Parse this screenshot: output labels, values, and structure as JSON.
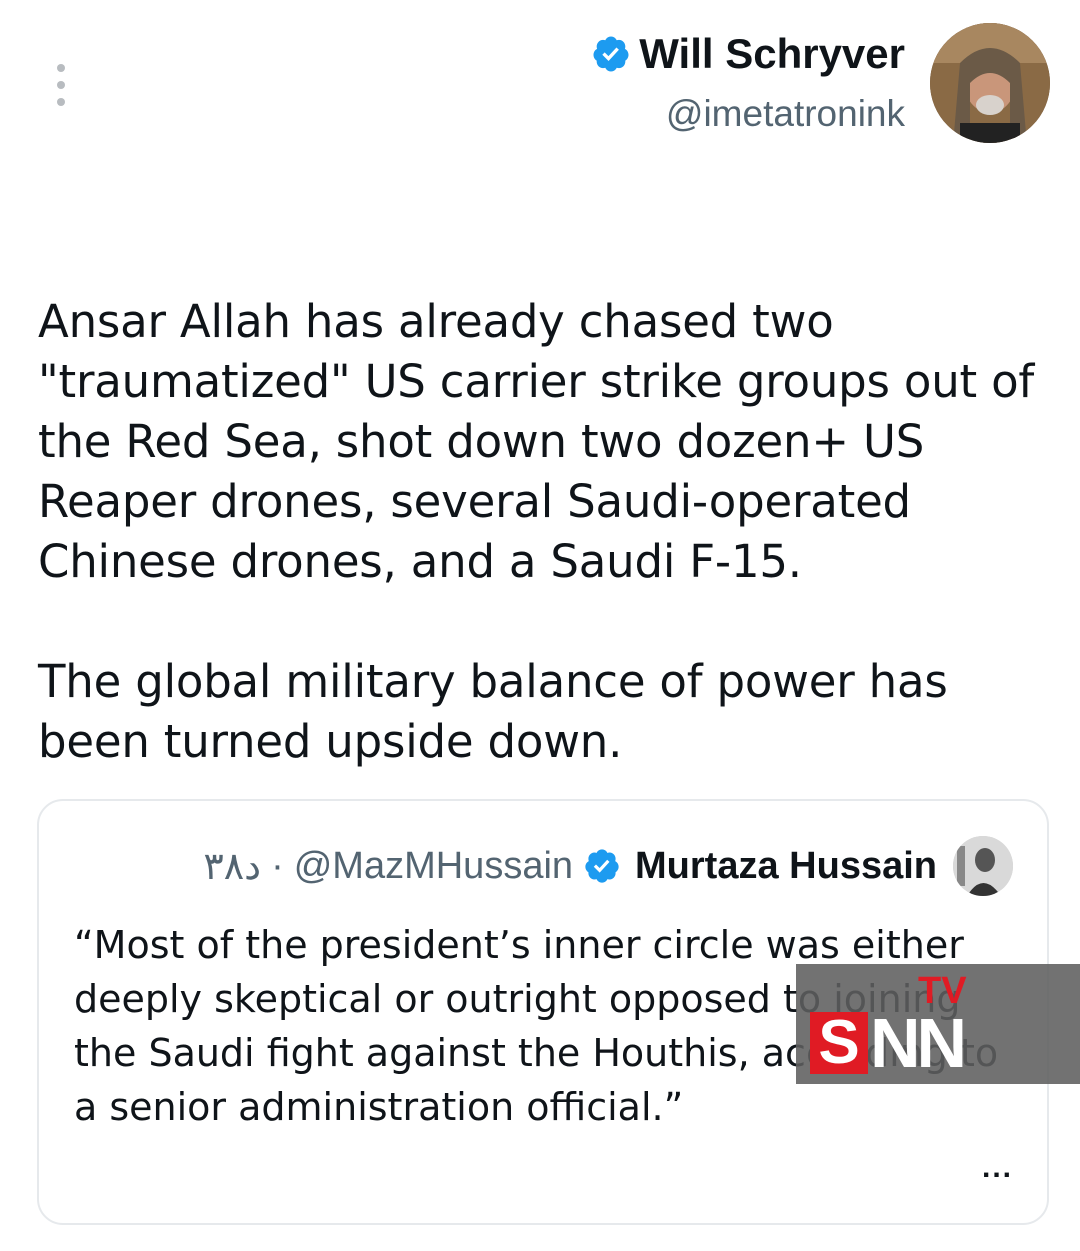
{
  "tweet": {
    "author": {
      "name": "Will Schryver",
      "handle": "@imetatronink",
      "verified": true
    },
    "paragraphs": [
      "Ansar Allah has already chased two \"traumatized\" US carrier strike groups out of the Red Sea, shot down two dozen+ US Reaper drones, several Saudi-operated Chinese drones, and a Saudi F-15.",
      "The global military balance of power has been turned upside down."
    ]
  },
  "quote": {
    "author": {
      "name": "Murtaza Hussain",
      "handle": "@MazMHussain",
      "verified": true
    },
    "time": "۳۸د",
    "separator": "·",
    "text": "“Most of the president’s inner circle was either deeply skeptical or outright opposed to joining the Saudi fight against the Houthis, according to a senior administration official.”",
    "more_label": "..."
  },
  "watermark": {
    "brand_letters": [
      "S",
      "NN"
    ],
    "brand_tv": "TV"
  },
  "colors": {
    "verified_blue": "#1d9bf0",
    "text_primary": "#0f1419",
    "text_secondary": "#536471",
    "border": "#e6e9ec",
    "watermark_red": "#e01b24"
  },
  "icons": {
    "menu": "more-vertical-icon",
    "verified": "verified-badge-icon",
    "more": "more-horizontal-icon"
  }
}
